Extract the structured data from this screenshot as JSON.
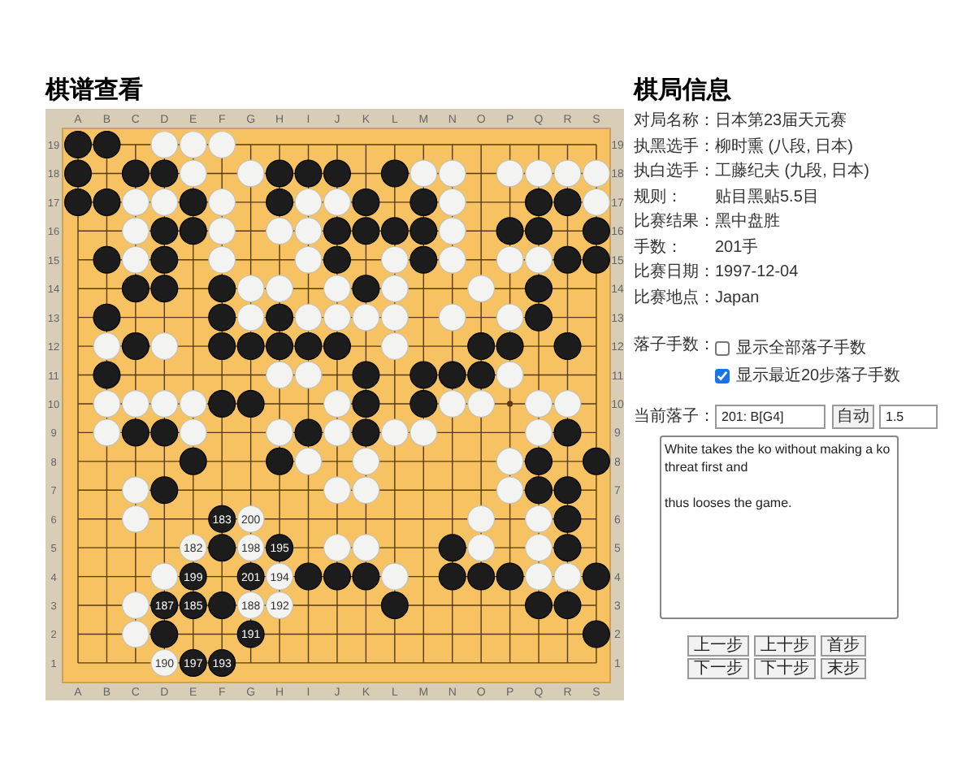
{
  "viewer_title": "棋谱查看",
  "board": {
    "top_labels": [
      "A",
      "B",
      "C",
      "D",
      "E",
      "F",
      "G",
      "H",
      "I",
      "J",
      "K",
      "L",
      "M",
      "N",
      "O",
      "P",
      "Q",
      "R",
      "S"
    ],
    "bottom_labels": [
      "A",
      "B",
      "C",
      "D",
      "E",
      "F",
      "G",
      "H",
      "I",
      "J",
      "K",
      "L",
      "M",
      "N",
      "O",
      "P",
      "Q",
      "R",
      "S"
    ],
    "left_labels": [
      "19",
      "18",
      "17",
      "16",
      "15",
      "14",
      "13",
      "12",
      "11",
      "10",
      "9",
      "8",
      "7",
      "6",
      "5",
      "4",
      "3",
      "2",
      "1"
    ],
    "right_labels": [
      "19",
      "18",
      "17",
      "16",
      "15",
      "14",
      "13",
      "12",
      "11",
      "10",
      "9",
      "8",
      "7",
      "6",
      "5",
      "4",
      "3",
      "2",
      "1"
    ],
    "rows": [
      {
        "cells": [
          {
            "kind": "black"
          },
          {
            "kind": "black"
          },
          {
            "kind": "empty"
          },
          {
            "kind": "white"
          },
          {
            "kind": "white"
          },
          {
            "kind": "white"
          },
          {
            "kind": "empty"
          },
          {
            "kind": "empty"
          },
          {
            "kind": "empty"
          },
          {
            "kind": "empty"
          },
          {
            "kind": "empty"
          },
          {
            "kind": "empty"
          },
          {
            "kind": "empty"
          },
          {
            "kind": "empty"
          },
          {
            "kind": "empty"
          },
          {
            "kind": "empty"
          },
          {
            "kind": "empty"
          },
          {
            "kind": "empty"
          },
          {
            "kind": "empty"
          }
        ]
      },
      {
        "cells": [
          {
            "kind": "black"
          },
          {
            "kind": "empty"
          },
          {
            "kind": "black"
          },
          {
            "kind": "black"
          },
          {
            "kind": "white"
          },
          {
            "kind": "empty"
          },
          {
            "kind": "white"
          },
          {
            "kind": "black"
          },
          {
            "kind": "black"
          },
          {
            "kind": "black"
          },
          {
            "kind": "empty"
          },
          {
            "kind": "black"
          },
          {
            "kind": "white"
          },
          {
            "kind": "white"
          },
          {
            "kind": "empty"
          },
          {
            "kind": "white"
          },
          {
            "kind": "white"
          },
          {
            "kind": "white"
          },
          {
            "kind": "white"
          }
        ]
      },
      {
        "cells": [
          {
            "kind": "black"
          },
          {
            "kind": "black"
          },
          {
            "kind": "white"
          },
          {
            "kind": "white"
          },
          {
            "kind": "black"
          },
          {
            "kind": "white"
          },
          {
            "kind": "empty"
          },
          {
            "kind": "black"
          },
          {
            "kind": "white"
          },
          {
            "kind": "white"
          },
          {
            "kind": "black"
          },
          {
            "kind": "empty"
          },
          {
            "kind": "black"
          },
          {
            "kind": "white"
          },
          {
            "kind": "empty"
          },
          {
            "kind": "empty"
          },
          {
            "kind": "black"
          },
          {
            "kind": "black"
          },
          {
            "kind": "white"
          }
        ]
      },
      {
        "cells": [
          {
            "kind": "empty"
          },
          {
            "kind": "empty"
          },
          {
            "kind": "white"
          },
          {
            "kind": "black"
          },
          {
            "kind": "black"
          },
          {
            "kind": "white"
          },
          {
            "kind": "empty"
          },
          {
            "kind": "white"
          },
          {
            "kind": "white"
          },
          {
            "kind": "black"
          },
          {
            "kind": "black"
          },
          {
            "kind": "black"
          },
          {
            "kind": "black"
          },
          {
            "kind": "white"
          },
          {
            "kind": "empty"
          },
          {
            "kind": "black"
          },
          {
            "kind": "black"
          },
          {
            "kind": "empty"
          },
          {
            "kind": "black"
          }
        ]
      },
      {
        "cells": [
          {
            "kind": "empty"
          },
          {
            "kind": "black"
          },
          {
            "kind": "white"
          },
          {
            "kind": "black"
          },
          {
            "kind": "empty"
          },
          {
            "kind": "white"
          },
          {
            "kind": "empty"
          },
          {
            "kind": "empty"
          },
          {
            "kind": "white"
          },
          {
            "kind": "black"
          },
          {
            "kind": "empty"
          },
          {
            "kind": "white"
          },
          {
            "kind": "black"
          },
          {
            "kind": "white"
          },
          {
            "kind": "empty"
          },
          {
            "kind": "white"
          },
          {
            "kind": "white"
          },
          {
            "kind": "black"
          },
          {
            "kind": "black"
          }
        ]
      },
      {
        "cells": [
          {
            "kind": "empty"
          },
          {
            "kind": "empty"
          },
          {
            "kind": "black"
          },
          {
            "kind": "black"
          },
          {
            "kind": "empty"
          },
          {
            "kind": "black"
          },
          {
            "kind": "white"
          },
          {
            "kind": "white"
          },
          {
            "kind": "empty"
          },
          {
            "kind": "white"
          },
          {
            "kind": "black"
          },
          {
            "kind": "white"
          },
          {
            "kind": "empty"
          },
          {
            "kind": "empty"
          },
          {
            "kind": "white"
          },
          {
            "kind": "empty"
          },
          {
            "kind": "black"
          },
          {
            "kind": "empty"
          },
          {
            "kind": "empty"
          }
        ]
      },
      {
        "cells": [
          {
            "kind": "empty"
          },
          {
            "kind": "black"
          },
          {
            "kind": "empty"
          },
          {
            "kind": "empty"
          },
          {
            "kind": "empty"
          },
          {
            "kind": "black"
          },
          {
            "kind": "white"
          },
          {
            "kind": "black"
          },
          {
            "kind": "white"
          },
          {
            "kind": "white"
          },
          {
            "kind": "white"
          },
          {
            "kind": "white"
          },
          {
            "kind": "empty"
          },
          {
            "kind": "white"
          },
          {
            "kind": "empty"
          },
          {
            "kind": "white"
          },
          {
            "kind": "black"
          },
          {
            "kind": "empty"
          },
          {
            "kind": "empty"
          }
        ]
      },
      {
        "cells": [
          {
            "kind": "empty"
          },
          {
            "kind": "white"
          },
          {
            "kind": "black"
          },
          {
            "kind": "white"
          },
          {
            "kind": "empty"
          },
          {
            "kind": "black"
          },
          {
            "kind": "black"
          },
          {
            "kind": "black"
          },
          {
            "kind": "black"
          },
          {
            "kind": "black"
          },
          {
            "kind": "empty"
          },
          {
            "kind": "white"
          },
          {
            "kind": "empty"
          },
          {
            "kind": "empty"
          },
          {
            "kind": "black"
          },
          {
            "kind": "black"
          },
          {
            "kind": "empty"
          },
          {
            "kind": "black"
          },
          {
            "kind": "empty"
          }
        ]
      },
      {
        "cells": [
          {
            "kind": "empty"
          },
          {
            "kind": "black"
          },
          {
            "kind": "empty"
          },
          {
            "kind": "empty"
          },
          {
            "kind": "empty"
          },
          {
            "kind": "empty"
          },
          {
            "kind": "empty"
          },
          {
            "kind": "white"
          },
          {
            "kind": "white"
          },
          {
            "kind": "empty"
          },
          {
            "kind": "black"
          },
          {
            "kind": "empty"
          },
          {
            "kind": "black"
          },
          {
            "kind": "black"
          },
          {
            "kind": "black"
          },
          {
            "kind": "white"
          },
          {
            "kind": "empty"
          },
          {
            "kind": "empty"
          },
          {
            "kind": "empty"
          }
        ]
      },
      {
        "cells": [
          {
            "kind": "empty"
          },
          {
            "kind": "white"
          },
          {
            "kind": "white"
          },
          {
            "kind": "white"
          },
          {
            "kind": "white"
          },
          {
            "kind": "black"
          },
          {
            "kind": "black"
          },
          {
            "kind": "empty"
          },
          {
            "kind": "empty"
          },
          {
            "kind": "white"
          },
          {
            "kind": "black"
          },
          {
            "kind": "empty"
          },
          {
            "kind": "black"
          },
          {
            "kind": "white"
          },
          {
            "kind": "white"
          },
          {
            "kind": "empty"
          },
          {
            "kind": "white"
          },
          {
            "kind": "white"
          },
          {
            "kind": "empty"
          }
        ]
      },
      {
        "cells": [
          {
            "kind": "empty"
          },
          {
            "kind": "white"
          },
          {
            "kind": "black"
          },
          {
            "kind": "black"
          },
          {
            "kind": "white"
          },
          {
            "kind": "empty"
          },
          {
            "kind": "empty"
          },
          {
            "kind": "white"
          },
          {
            "kind": "black"
          },
          {
            "kind": "white"
          },
          {
            "kind": "black"
          },
          {
            "kind": "white"
          },
          {
            "kind": "white"
          },
          {
            "kind": "empty"
          },
          {
            "kind": "empty"
          },
          {
            "kind": "empty"
          },
          {
            "kind": "white"
          },
          {
            "kind": "black"
          },
          {
            "kind": "empty"
          }
        ]
      },
      {
        "cells": [
          {
            "kind": "empty"
          },
          {
            "kind": "empty"
          },
          {
            "kind": "empty"
          },
          {
            "kind": "empty"
          },
          {
            "kind": "black"
          },
          {
            "kind": "empty"
          },
          {
            "kind": "empty"
          },
          {
            "kind": "black"
          },
          {
            "kind": "white"
          },
          {
            "kind": "empty"
          },
          {
            "kind": "white"
          },
          {
            "kind": "empty"
          },
          {
            "kind": "empty"
          },
          {
            "kind": "empty"
          },
          {
            "kind": "empty"
          },
          {
            "kind": "white"
          },
          {
            "kind": "black"
          },
          {
            "kind": "empty"
          },
          {
            "kind": "black"
          }
        ]
      },
      {
        "cells": [
          {
            "kind": "empty"
          },
          {
            "kind": "empty"
          },
          {
            "kind": "white"
          },
          {
            "kind": "black"
          },
          {
            "kind": "empty"
          },
          {
            "kind": "empty"
          },
          {
            "kind": "empty"
          },
          {
            "kind": "empty"
          },
          {
            "kind": "empty"
          },
          {
            "kind": "white"
          },
          {
            "kind": "white"
          },
          {
            "kind": "empty"
          },
          {
            "kind": "empty"
          },
          {
            "kind": "empty"
          },
          {
            "kind": "empty"
          },
          {
            "kind": "white"
          },
          {
            "kind": "black"
          },
          {
            "kind": "black"
          },
          {
            "kind": "empty"
          }
        ]
      },
      {
        "cells": [
          {
            "kind": "empty"
          },
          {
            "kind": "empty"
          },
          {
            "kind": "white"
          },
          {
            "kind": "empty"
          },
          {
            "kind": "empty"
          },
          {
            "kind": "black",
            "label": "183"
          },
          {
            "kind": "white",
            "label": "200"
          },
          {
            "kind": "empty"
          },
          {
            "kind": "empty"
          },
          {
            "kind": "empty"
          },
          {
            "kind": "empty"
          },
          {
            "kind": "empty"
          },
          {
            "kind": "empty"
          },
          {
            "kind": "empty"
          },
          {
            "kind": "white"
          },
          {
            "kind": "empty"
          },
          {
            "kind": "white"
          },
          {
            "kind": "black"
          },
          {
            "kind": "empty"
          }
        ]
      },
      {
        "cells": [
          {
            "kind": "empty"
          },
          {
            "kind": "empty"
          },
          {
            "kind": "empty"
          },
          {
            "kind": "empty"
          },
          {
            "kind": "white",
            "label": "182"
          },
          {
            "kind": "black"
          },
          {
            "kind": "white",
            "label": "198"
          },
          {
            "kind": "black",
            "label": "195"
          },
          {
            "kind": "empty"
          },
          {
            "kind": "white"
          },
          {
            "kind": "white"
          },
          {
            "kind": "empty"
          },
          {
            "kind": "empty"
          },
          {
            "kind": "black"
          },
          {
            "kind": "white"
          },
          {
            "kind": "empty"
          },
          {
            "kind": "white"
          },
          {
            "kind": "black"
          },
          {
            "kind": "empty"
          }
        ]
      },
      {
        "cells": [
          {
            "kind": "empty"
          },
          {
            "kind": "empty"
          },
          {
            "kind": "empty"
          },
          {
            "kind": "white"
          },
          {
            "kind": "black",
            "label": "199"
          },
          {
            "kind": "empty"
          },
          {
            "kind": "black",
            "label": "201"
          },
          {
            "kind": "white",
            "label": "194"
          },
          {
            "kind": "black"
          },
          {
            "kind": "black"
          },
          {
            "kind": "black"
          },
          {
            "kind": "white"
          },
          {
            "kind": "empty"
          },
          {
            "kind": "black"
          },
          {
            "kind": "black"
          },
          {
            "kind": "black"
          },
          {
            "kind": "white"
          },
          {
            "kind": "white"
          },
          {
            "kind": "black"
          }
        ]
      },
      {
        "cells": [
          {
            "kind": "empty"
          },
          {
            "kind": "empty"
          },
          {
            "kind": "white"
          },
          {
            "kind": "black",
            "label": "187"
          },
          {
            "kind": "black",
            "label": "185"
          },
          {
            "kind": "black"
          },
          {
            "kind": "white",
            "label": "188"
          },
          {
            "kind": "white",
            "label": "192"
          },
          {
            "kind": "empty"
          },
          {
            "kind": "empty"
          },
          {
            "kind": "empty"
          },
          {
            "kind": "black"
          },
          {
            "kind": "empty"
          },
          {
            "kind": "empty"
          },
          {
            "kind": "empty"
          },
          {
            "kind": "empty"
          },
          {
            "kind": "black"
          },
          {
            "kind": "black"
          },
          {
            "kind": "empty"
          }
        ]
      },
      {
        "cells": [
          {
            "kind": "empty"
          },
          {
            "kind": "empty"
          },
          {
            "kind": "white"
          },
          {
            "kind": "black"
          },
          {
            "kind": "empty"
          },
          {
            "kind": "empty"
          },
          {
            "kind": "black",
            "label": "191"
          },
          {
            "kind": "empty"
          },
          {
            "kind": "empty"
          },
          {
            "kind": "empty"
          },
          {
            "kind": "empty"
          },
          {
            "kind": "empty"
          },
          {
            "kind": "empty"
          },
          {
            "kind": "empty"
          },
          {
            "kind": "empty"
          },
          {
            "kind": "empty"
          },
          {
            "kind": "empty"
          },
          {
            "kind": "empty"
          },
          {
            "kind": "black"
          }
        ]
      },
      {
        "cells": [
          {
            "kind": "empty"
          },
          {
            "kind": "empty"
          },
          {
            "kind": "empty"
          },
          {
            "kind": "white",
            "label": "190"
          },
          {
            "kind": "black",
            "label": "197"
          },
          {
            "kind": "black",
            "label": "193"
          },
          {
            "kind": "empty"
          },
          {
            "kind": "empty"
          },
          {
            "kind": "empty"
          },
          {
            "kind": "empty"
          },
          {
            "kind": "empty"
          },
          {
            "kind": "empty"
          },
          {
            "kind": "empty"
          },
          {
            "kind": "empty"
          },
          {
            "kind": "empty"
          },
          {
            "kind": "empty"
          },
          {
            "kind": "empty"
          },
          {
            "kind": "empty"
          },
          {
            "kind": "empty"
          }
        ]
      }
    ]
  },
  "info": {
    "title": "棋局信息",
    "fields": [
      {
        "label": "对局名称：",
        "value": "日本第23届天元赛"
      },
      {
        "label": "执黑选手：",
        "value": "柳时熏 (八段, 日本)"
      },
      {
        "label": "执白选手：",
        "value": "工藤纪夫 (九段, 日本)"
      },
      {
        "label": "规则：",
        "value": "贴目黑贴5.5目"
      },
      {
        "label": "比赛结果：",
        "value": "黑中盘胜"
      },
      {
        "label": "手数：",
        "value": "201手"
      },
      {
        "label": "比赛日期：",
        "value": "1997-12-04"
      },
      {
        "label": "比赛地点：",
        "value": "Japan"
      }
    ]
  },
  "move_display": {
    "label": "落子手数：",
    "options": [
      {
        "label": "显示全部落子手数",
        "checked": false
      },
      {
        "label": "显示最近20步落子手数",
        "checked": true
      }
    ]
  },
  "current_move": {
    "label": "当前落子：",
    "value": "201: B[G4]",
    "auto_button": "自动",
    "interval": "1.5"
  },
  "comment": "White takes the ko without making a ko threat first and\n\nthus looses the game.",
  "nav_buttons": [
    [
      "上一步",
      "上十步",
      "首步"
    ],
    [
      "下一步",
      "下十步",
      "末步"
    ]
  ]
}
